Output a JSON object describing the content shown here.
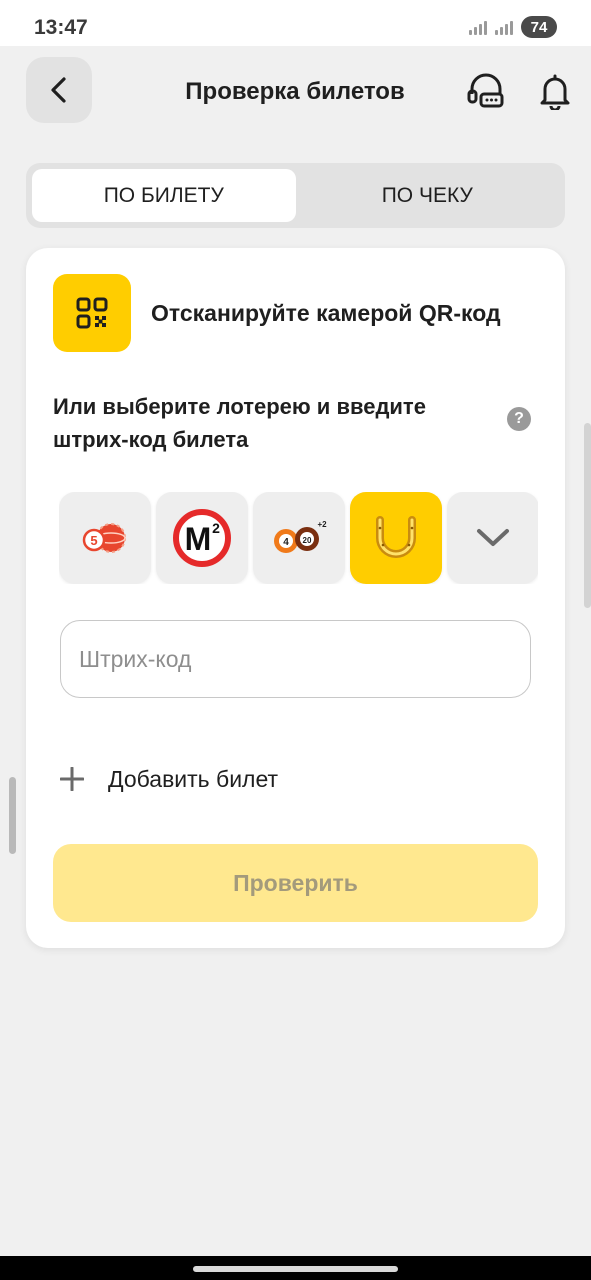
{
  "status_bar": {
    "time": "13:47",
    "battery": "74"
  },
  "header": {
    "title": "Проверка билетов",
    "back_icon": "chevron-left-icon",
    "support_icon": "headset-chat-icon",
    "notifications_icon": "bell-icon"
  },
  "tabs": [
    {
      "label": "ПО БИЛЕТУ",
      "active": true
    },
    {
      "label": "ПО ЧЕКУ",
      "active": false
    }
  ],
  "card": {
    "qr_icon": "qr-code-icon",
    "qr_text": "Отсканируйте камерой QR-код",
    "instruction": "Или выберите лотерею и введите штрих-код билета",
    "help_icon": "question-icon",
    "help_glyph": "?",
    "lotteries": [
      {
        "icon": "bingo-balls-icon",
        "selected": false
      },
      {
        "icon": "m2-logo-icon",
        "selected": false
      },
      {
        "icon": "4-20-balls-icon",
        "selected": false
      },
      {
        "icon": "horseshoe-icon",
        "selected": true
      },
      {
        "icon": "chevron-down-icon",
        "selected": false
      }
    ],
    "barcode_placeholder": "Штрих-код",
    "add_ticket_label": "Добавить билет",
    "check_button_label": "Проверить"
  },
  "colors": {
    "accent": "#ffcd00",
    "button_disabled": "#ffe88f",
    "background": "#f0f0f0",
    "surface": "#ffffff"
  }
}
